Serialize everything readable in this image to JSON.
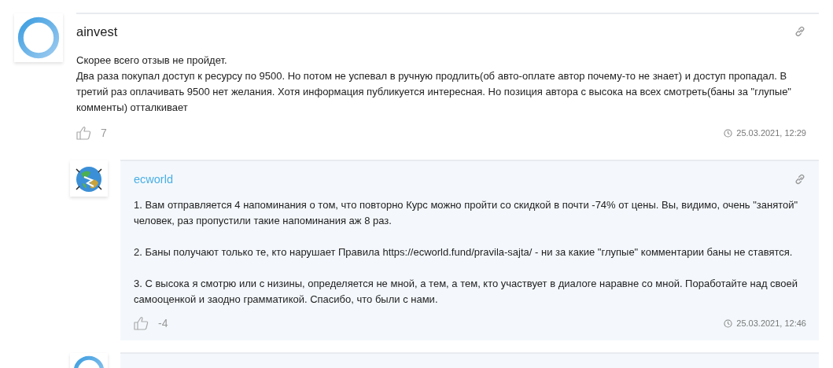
{
  "comments": [
    {
      "kind": "top",
      "avatar": {
        "kind": "ring"
      },
      "author": "ainvest",
      "paragraphs": [
        "Скорее всего отзыв не пройдет.\nДва раза покупал доступ к ресурсу по 9500. Но потом не успевал в ручную продлить(об авто-оплате автор почему-то не знает) и доступ пропадал. В третий раз оплачивать 9500 нет желания. Хотя информация публикуется интересная. Но позиция автора с высока на всех смотреть(баны за \"глупые\" комменты) отталкивает"
      ],
      "likes": "7",
      "date": "25.03.2021, 12:29"
    },
    {
      "kind": "reply",
      "avatar": {
        "kind": "globe"
      },
      "author": "ecworld",
      "paragraphs": [
        "1. Вам отправляется 4 напоминания о том, что повторно Курс можно пройти со скидкой в почти -74% от цены. Вы, видимо, очень \"занятой\" человек, раз пропустили такие напоминания аж 8 раз.",
        "2. Баны получают только те, кто нарушает Правила https://ecworld.fund/pravila-sajta/ - ни за какие \"глупые\" комментарии баны не ставятся.",
        "3. С высока я смотрю или с низины, определяется не мной, а тем, а тем, кто участвует в диалоге наравне со мной. Поработайте над своей самооценкой и заодно грамматикой. Спасибо, что были с нами."
      ],
      "likes": "-4",
      "date": "25.03.2021, 12:46"
    },
    {
      "kind": "reply",
      "avatar": {
        "kind": "ring"
      }
    }
  ]
}
